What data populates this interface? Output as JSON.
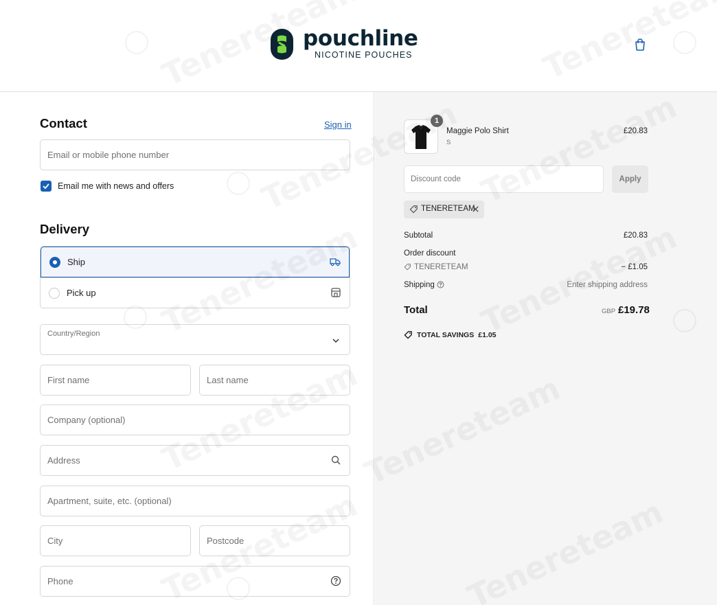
{
  "header": {
    "brand_name": "pouchline",
    "brand_tagline": "NICOTINE POUCHES",
    "cart_icon": "shopping-bag-icon"
  },
  "contact": {
    "title": "Contact",
    "sign_in": "Sign in",
    "email_placeholder": "Email or mobile phone number",
    "newsletter_label": "Email me with news and offers",
    "newsletter_checked": true
  },
  "delivery": {
    "title": "Delivery",
    "options": [
      {
        "label": "Ship",
        "selected": true,
        "icon": "truck-icon"
      },
      {
        "label": "Pick up",
        "selected": false,
        "icon": "store-icon"
      }
    ],
    "country_label": "Country/Region",
    "first_name": "First name",
    "last_name": "Last name",
    "company": "Company (optional)",
    "address": "Address",
    "apartment": "Apartment, suite, etc. (optional)",
    "city": "City",
    "postcode": "Postcode",
    "phone": "Phone"
  },
  "summary": {
    "item": {
      "name": "Maggie Polo Shirt",
      "variant": "S",
      "price": "£20.83",
      "quantity": "1"
    },
    "discount_placeholder": "Discount code",
    "apply_label": "Apply",
    "applied_code": "TENERETEAM",
    "subtotal_label": "Subtotal",
    "subtotal_value": "£20.83",
    "order_discount_label": "Order discount",
    "order_discount_code": "TENERETEAM",
    "order_discount_value": "− £1.05",
    "shipping_label": "Shipping",
    "shipping_value": "Enter shipping address",
    "total_label": "Total",
    "total_currency": "GBP",
    "total_value": "£19.78",
    "savings_label": "TOTAL SAVINGS",
    "savings_value": "£1.05"
  },
  "colors": {
    "accent": "#1a5fb4",
    "brand_dark": "#0d2533",
    "brand_green": "#7cd944"
  },
  "watermark_text": "Tenereteam"
}
